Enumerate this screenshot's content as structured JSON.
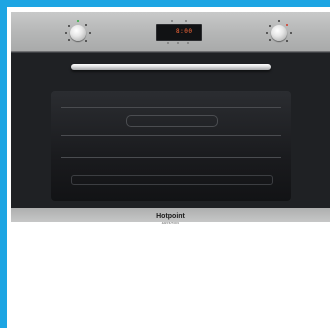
{
  "image": {
    "subject": "built-in oven",
    "frame_color": "#1ca5e3",
    "finish_color": "#b8b9b9",
    "door_color": "#1f2124"
  },
  "control_panel": {
    "left_knob_icon": "function-selector-knob-icon",
    "right_knob_icon": "temperature-knob-icon",
    "display_time": "8:00"
  },
  "branding": {
    "name": "Hotpoint",
    "subline": "ARISTON"
  }
}
